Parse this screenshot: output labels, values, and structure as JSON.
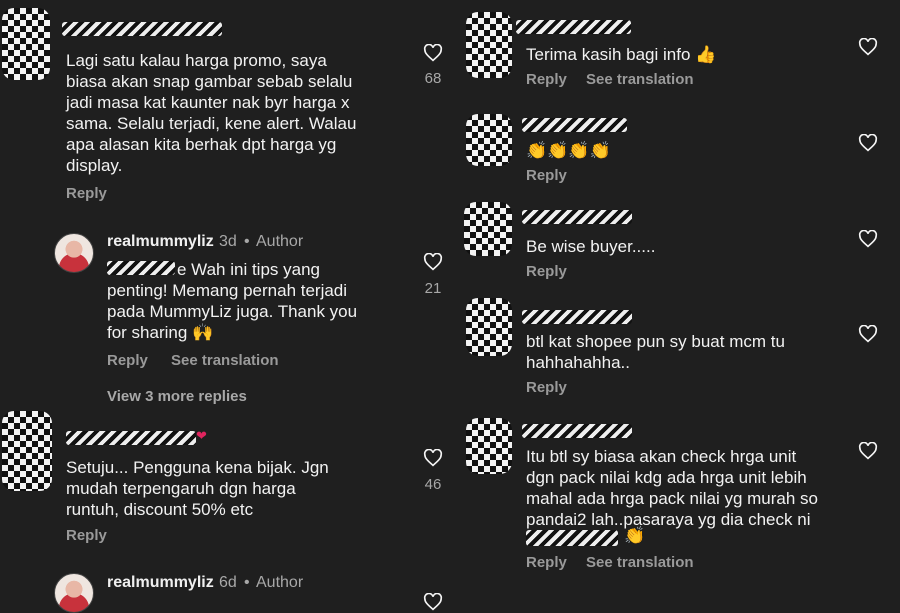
{
  "left": {
    "c1": {
      "body": "Lagi satu kalau harga promo, saya\nbiasa akan snap gambar sebab selalu\njadi masa kat kaunter nak byr harga x\nsama. Selalu terjadi, kene alert. Walau\napa alasan kita berhak dpt harga yg\ndisplay.",
      "reply": "Reply",
      "likes": "68"
    },
    "r1": {
      "name": "realmummyliz",
      "time": "3d",
      "sep": "•",
      "author": "Author",
      "body": "e Wah ini tips yang\npenting! Memang pernah terjadi\npada MummyLiz juga. Thank you\nfor sharing 🙌",
      "reply": "Reply",
      "translate": "See translation",
      "likes": "21"
    },
    "view_more": "View 3 more replies",
    "c2": {
      "body": "Setuju... Pengguna kena bijak. Jgn\nmudah terpengaruh dgn harga\nruntuh, discount 50% etc",
      "reply": "Reply",
      "likes": "46"
    },
    "r2": {
      "name": "realmummyliz",
      "time": "6d",
      "sep": "•",
      "author": "Author"
    }
  },
  "right": {
    "c1": {
      "body": "Terima kasih bagi info 👍",
      "reply": "Reply",
      "translate": "See translation"
    },
    "c2": {
      "body": "👏👏👏👏",
      "reply": "Reply"
    },
    "c3": {
      "body": "Be wise buyer.....",
      "reply": "Reply"
    },
    "c4": {
      "body": "btl kat shopee pun sy buat mcm tu\nhahhahahha..",
      "reply": "Reply"
    },
    "c5": {
      "body": "Itu btl sy biasa akan check hrga unit\ndgn pack nilai kdg ada hrga unit lebih\nmahal ada hrga pack nilai yg murah so\npandai2 lah..pasaraya yg dia check ni",
      "emoji": "👏",
      "reply": "Reply",
      "translate": "See translation"
    }
  },
  "icons": {
    "heart": "heart-outline-icon"
  }
}
